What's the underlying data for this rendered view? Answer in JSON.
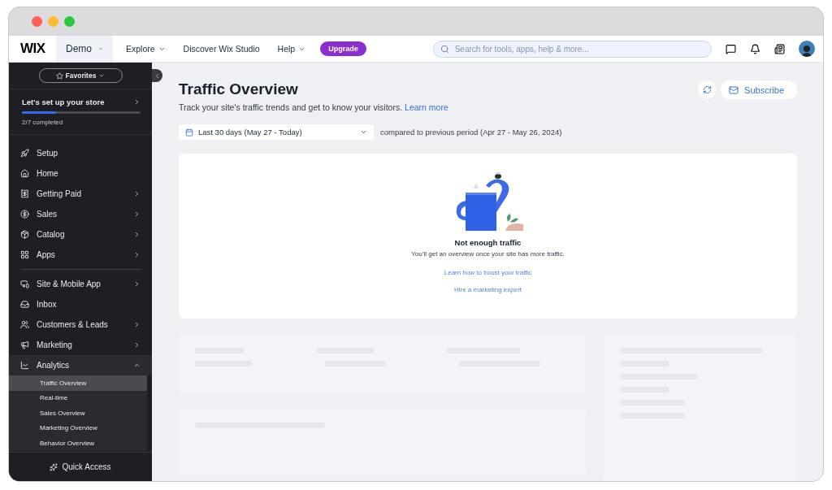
{
  "topbar": {
    "logo": "WIX",
    "site": {
      "label": "Demo",
      "dropdown": true
    },
    "nav": [
      {
        "label": "Explore",
        "dropdown": true
      },
      {
        "label": "Discover Wix Studio",
        "dropdown": false
      },
      {
        "label": "Help",
        "dropdown": true
      }
    ],
    "upgrade": "Upgrade",
    "search": {
      "placeholder": "Search for tools, apps, help & more..."
    }
  },
  "sidebar": {
    "favorites": "Favorites",
    "setup": {
      "title": "Let's set up your store",
      "level": 0.29,
      "progress": "2/7 completed"
    },
    "groups": [
      [
        {
          "label": "Setup",
          "chevron": false,
          "expanded": false
        },
        {
          "label": "Home",
          "chevron": false,
          "expanded": false
        },
        {
          "label": "Getting Paid",
          "chevron": true,
          "expanded": false
        },
        {
          "label": "Sales",
          "chevron": true,
          "expanded": false
        },
        {
          "label": "Catalog",
          "chevron": true,
          "expanded": false
        },
        {
          "label": "Apps",
          "chevron": true,
          "expanded": false
        }
      ],
      [
        {
          "label": "Site & Mobile App",
          "chevron": true,
          "expanded": false
        },
        {
          "label": "Inbox",
          "chevron": false,
          "expanded": false
        },
        {
          "label": "Customers & Leads",
          "chevron": true,
          "expanded": false
        },
        {
          "label": "Marketing",
          "chevron": true,
          "expanded": false
        },
        {
          "label": "Analytics",
          "chevron": true,
          "expanded": true,
          "children": [
            {
              "label": "Traffic Overview",
              "selected": true
            },
            {
              "label": "Real-time",
              "selected": false
            },
            {
              "label": "Sales Overview",
              "selected": false
            },
            {
              "label": "Marketing Overview",
              "selected": false
            },
            {
              "label": "Behavior Overview",
              "selected": false
            }
          ]
        }
      ]
    ],
    "quick_access": "Quick Access"
  },
  "page": {
    "title": "Traffic Overview",
    "subtitle": "Track your site's traffic trends and get to know your visitors.",
    "learn_more": "Learn more",
    "subscribe": "Subscribe",
    "date_range": "Last 30 days (May 27 - Today)",
    "comparison": "compared to previous period (Apr 27 - May 26, 2024)",
    "empty": {
      "title": "Not enough traffic",
      "text": "You’ll get an overview once your site has more traffic.",
      "links": [
        "Learn how to boost your traffic",
        "Hire a marketing expert"
      ]
    }
  }
}
